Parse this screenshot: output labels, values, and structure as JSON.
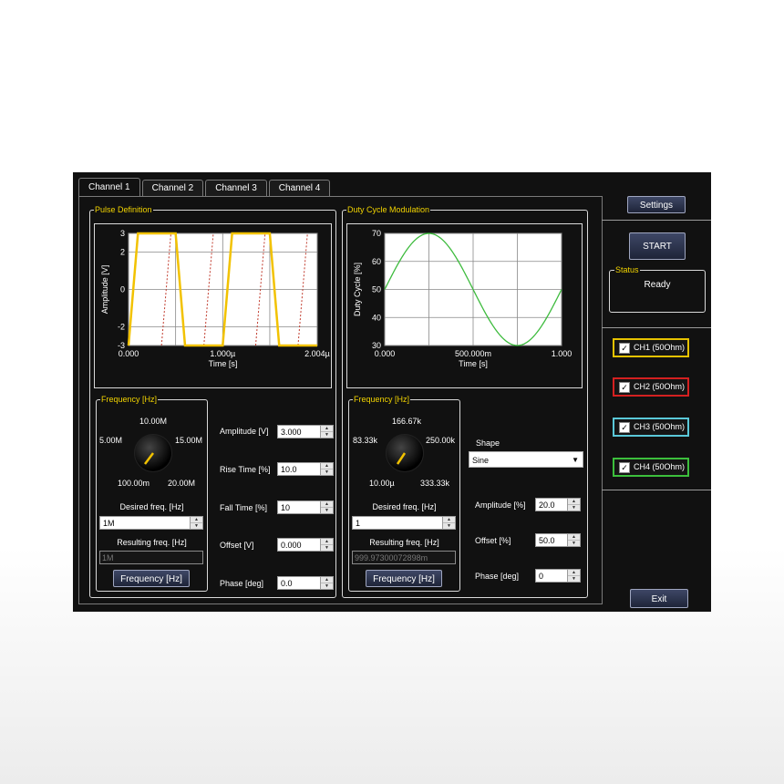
{
  "tabs": [
    "Channel 1",
    "Channel 2",
    "Channel 3",
    "Channel 4"
  ],
  "pulse": {
    "title": "Pulse Definition",
    "plot": {
      "ylabel": "Amplitude [V]",
      "xlabel": "Time [s]",
      "yticks": [
        "3",
        "2",
        "0",
        "-2",
        "-3"
      ],
      "xticks": [
        "0.000",
        "1.000µ",
        "2.004µ"
      ],
      "colors": {
        "main": "#f2c200",
        "ghost": "#c0392b"
      }
    },
    "freq_group": {
      "title": "Frequency [Hz]",
      "knob_labels": {
        "top": "10.00M",
        "left": "5.00M",
        "right": "15.00M",
        "bl": "100.00m",
        "br": "20.00M"
      },
      "desired_label": "Desired freq. [Hz]",
      "desired_value": "1M",
      "resulting_label": "Resulting freq. [Hz]",
      "resulting_value": "1M",
      "button": "Frequency [Hz]"
    },
    "params": [
      {
        "label": "Amplitude [V]",
        "value": "3.000"
      },
      {
        "label": "Rise Time [%]",
        "value": "10.0"
      },
      {
        "label": "Fall Time [%]",
        "value": "10"
      },
      {
        "label": "Offset [V]",
        "value": "0.000"
      },
      {
        "label": "Phase [deg]",
        "value": "0.0"
      }
    ]
  },
  "duty": {
    "title": "Duty Cycle Modulation",
    "plot": {
      "ylabel": "Duty Cycle [%]",
      "xlabel": "Time [s]",
      "yticks": [
        "70",
        "60",
        "50",
        "40",
        "30"
      ],
      "xticks": [
        "0.000",
        "500.000m",
        "1.000"
      ],
      "color": "#3dbb3d"
    },
    "freq_group": {
      "title": "Frequency [Hz]",
      "knob_labels": {
        "top": "166.67k",
        "left": "83.33k",
        "right": "250.00k",
        "bl": "10.00µ",
        "br": "333.33k"
      },
      "desired_label": "Desired freq. [Hz]",
      "desired_value": "1",
      "resulting_label": "Resulting freq. [Hz]",
      "resulting_value": "999.97300072898m",
      "button": "Frequency [Hz]"
    },
    "shape_label": "Shape",
    "shape_value": "Sine",
    "params": [
      {
        "label": "Amplitude [%]",
        "value": "20.0"
      },
      {
        "label": "Offset [%]",
        "value": "50.0"
      },
      {
        "label": "Phase [deg]",
        "value": "0"
      }
    ]
  },
  "side": {
    "settings": "Settings",
    "start": "START",
    "status_title": "Status",
    "status": "Ready",
    "channels": [
      {
        "label": "CH1 (50Ohm)",
        "color": "#e6c200",
        "checked": true
      },
      {
        "label": "CH2 (50Ohm)",
        "color": "#d42020",
        "checked": true
      },
      {
        "label": "CH3 (50Ohm)",
        "color": "#5ac8d8",
        "checked": true
      },
      {
        "label": "CH4 (50Ohm)",
        "color": "#3cbf3c",
        "checked": true
      }
    ],
    "exit": "Exit"
  },
  "chart_data": [
    {
      "type": "line",
      "ylabel": "Amplitude [V]",
      "xlabel": "Time [s]",
      "ylim": [
        -3,
        3
      ],
      "xlim": [
        0,
        2.004
      ],
      "x_unit_note": "µs",
      "series": [
        {
          "x": [
            0,
            0.1,
            0.5,
            0.6,
            1.0,
            1.1,
            1.5,
            1.6,
            2.004
          ],
          "y": [
            -3,
            3,
            3,
            -3,
            -3,
            3,
            3,
            -3,
            -3
          ]
        }
      ]
    },
    {
      "type": "line",
      "ylabel": "Duty Cycle [%]",
      "xlabel": "Time [s]",
      "ylim": [
        30,
        70
      ],
      "xlim": [
        0,
        1.0
      ],
      "series": [
        {
          "x": [
            0,
            0.125,
            0.25,
            0.375,
            0.5,
            0.625,
            0.75,
            0.875,
            1.0
          ],
          "y": [
            50,
            64.1,
            70,
            64.1,
            50,
            35.9,
            30,
            35.9,
            50
          ]
        }
      ]
    }
  ]
}
